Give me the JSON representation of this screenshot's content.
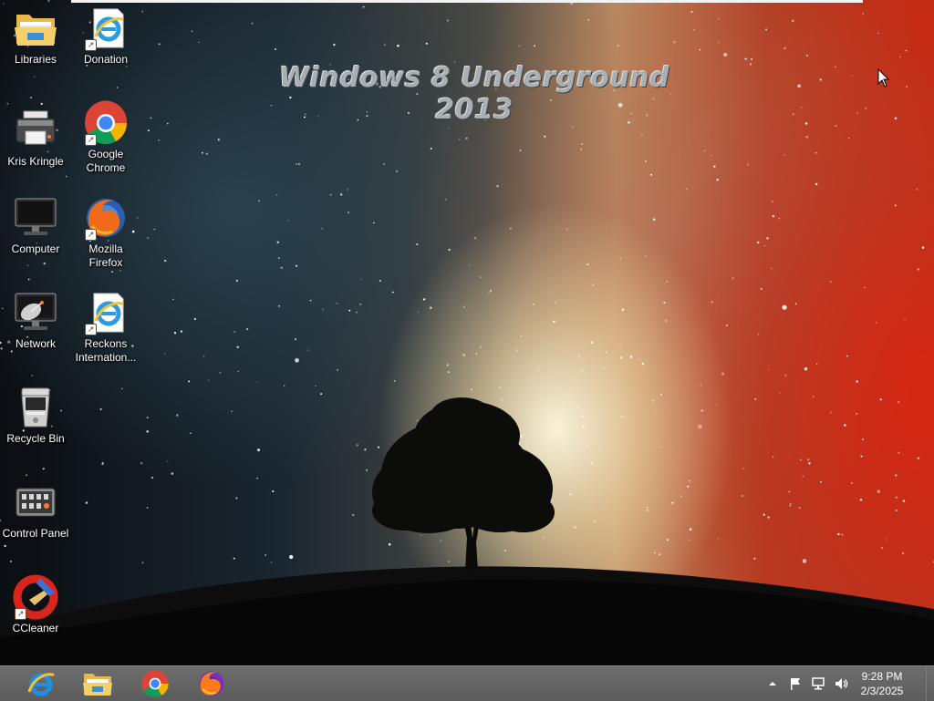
{
  "wallpaper": {
    "watermark": "Windows 8 Underground 2013"
  },
  "desktop": {
    "icons": [
      {
        "label": "Libraries",
        "icon": "libraries-folder-icon"
      },
      {
        "label": "Donation",
        "icon": "internet-explorer-icon"
      },
      {
        "label": "Kris Kringle",
        "icon": "printer-icon"
      },
      {
        "label": "Google Chrome",
        "icon": "chrome-icon"
      },
      {
        "label": "Computer",
        "icon": "monitor-icon"
      },
      {
        "label": "Mozilla Firefox",
        "icon": "firefox-icon"
      },
      {
        "label": "Network",
        "icon": "network-satellite-icon"
      },
      {
        "label": "Reckons Internation...",
        "icon": "internet-explorer-icon"
      },
      {
        "label": "Recycle Bin",
        "icon": "recycle-bin-icon"
      },
      {
        "label": "Control Panel",
        "icon": "control-panel-icon"
      },
      {
        "label": "CCleaner",
        "icon": "ccleaner-icon"
      }
    ]
  },
  "taskbar": {
    "pinned": [
      "internet-explorer-icon",
      "file-explorer-icon",
      "chrome-icon",
      "firefox-icon"
    ],
    "tray": {
      "icons": [
        "show-hidden-icons-arrow",
        "action-center-flag-icon",
        "network-icon",
        "volume-icon"
      ],
      "time": "9:28 PM",
      "date": "2/3/2025"
    }
  },
  "colors": {
    "taskbar": "#5f5f5f",
    "label_text": "#ffffff",
    "watermark": "#a9afb3"
  }
}
